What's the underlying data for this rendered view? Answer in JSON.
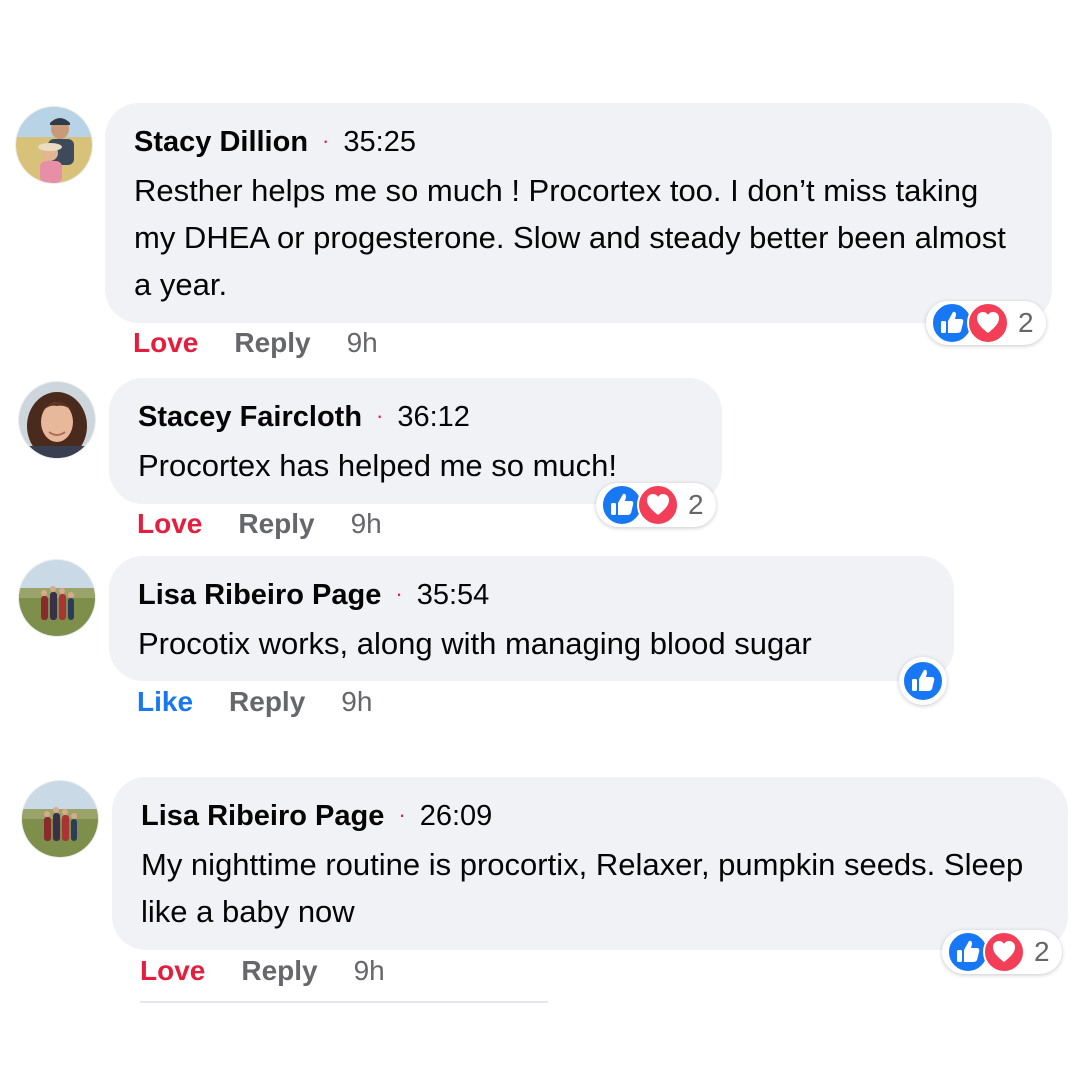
{
  "comments": [
    {
      "author": "Stacy Dillion",
      "timestamp": "35:25",
      "text": "Resther helps me so much ! Procortex too. I don’t miss taking my DHEA or progesterone. Slow and steady better been almost a year.",
      "action_react": "Love",
      "action_reply": "Reply",
      "age": "9h",
      "reaction_count": "2"
    },
    {
      "author": "Stacey Faircloth",
      "timestamp": "36:12",
      "text": "Procortex has helped me so much!",
      "action_react": "Love",
      "action_reply": "Reply",
      "age": "9h",
      "reaction_count": "2"
    },
    {
      "author": "Lisa Ribeiro Page",
      "timestamp": "35:54",
      "text": "Procotix works, along with managing blood sugar",
      "action_react": "Like",
      "action_reply": "Reply",
      "age": "9h",
      "reaction_count": ""
    },
    {
      "author": "Lisa Ribeiro Page",
      "timestamp": "26:09",
      "text": "My nighttime routine is procortix, Relaxer, pumpkin seeds. Sleep like a baby now",
      "action_react": "Love",
      "action_reply": "Reply",
      "age": "9h",
      "reaction_count": "2"
    }
  ],
  "colors": {
    "bubble": "#f0f2f5",
    "love": "#e41e3f",
    "like": "#1877f2",
    "muted": "#65676b"
  },
  "icons": {
    "like": "thumbs-up-icon",
    "love": "heart-icon"
  }
}
